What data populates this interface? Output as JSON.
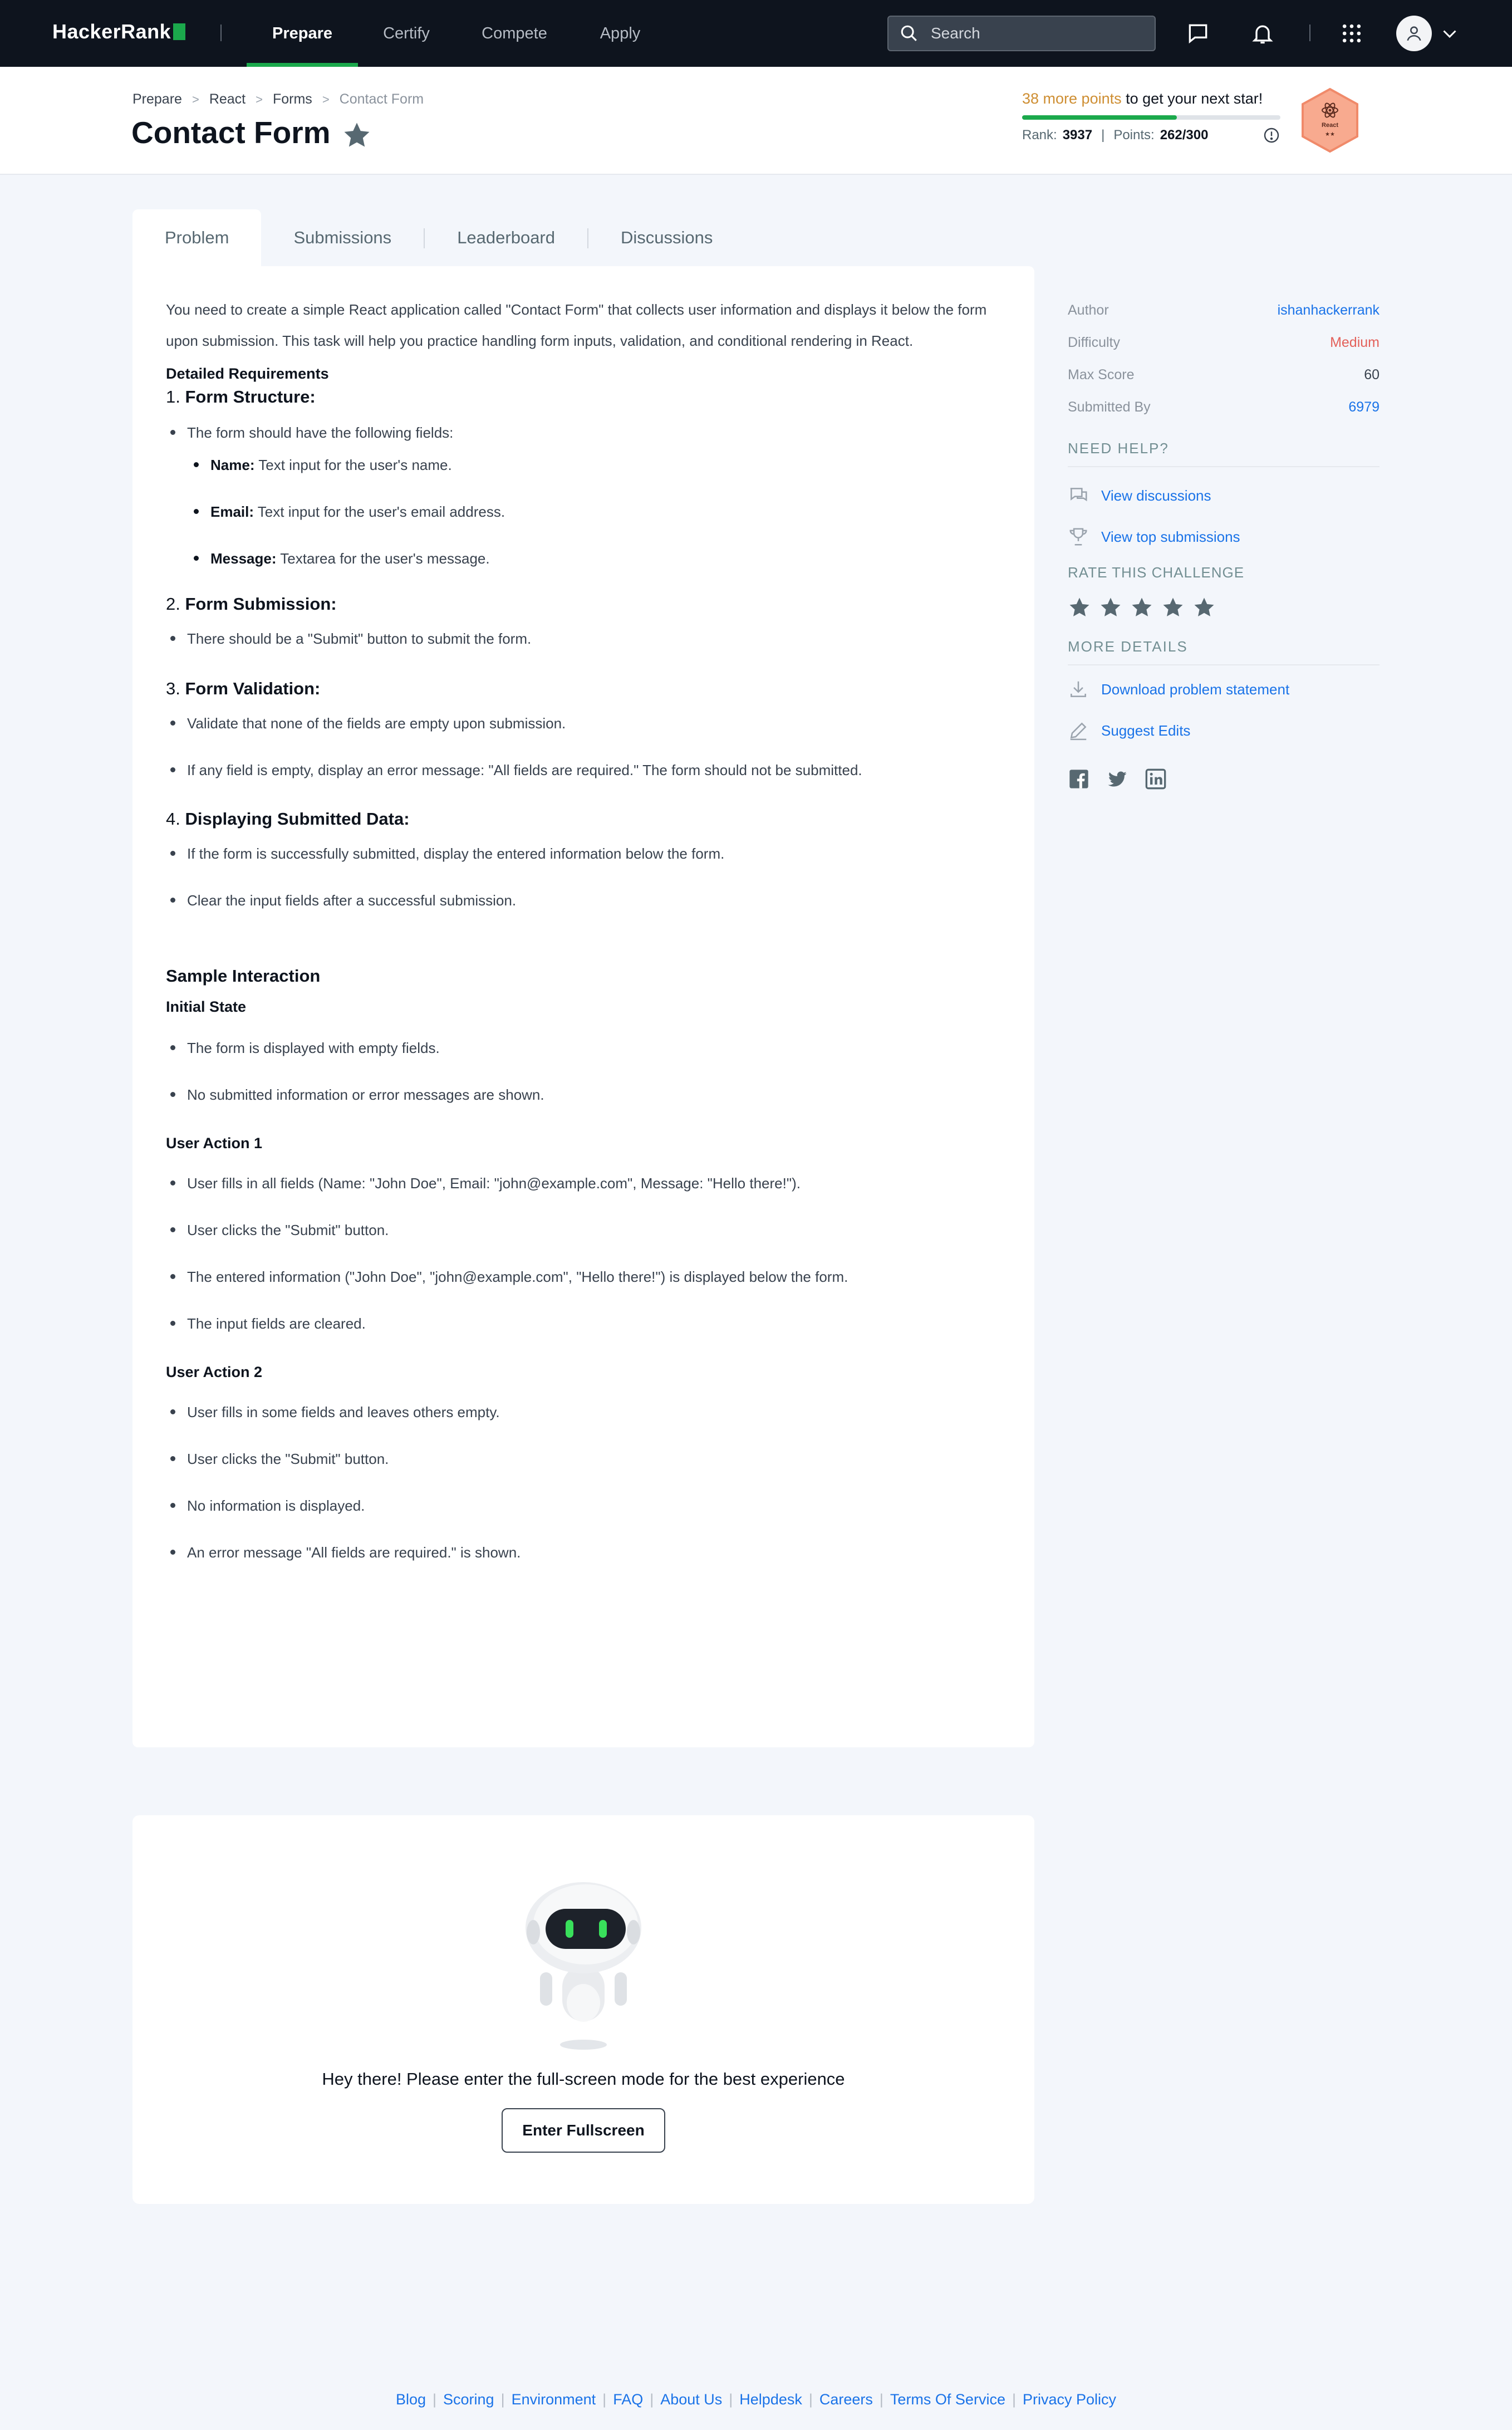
{
  "nav": {
    "logo": "HackerRank",
    "items": [
      "Prepare",
      "Certify",
      "Compete",
      "Apply"
    ],
    "active": "Prepare",
    "search_placeholder": "Search"
  },
  "header": {
    "breadcrumb": [
      "Prepare",
      "React",
      "Forms",
      "Contact Form"
    ],
    "title": "Contact Form",
    "points_needed": "38 more points",
    "points_suffix": " to get your next star!",
    "progress_fraction": 0.6,
    "rank_label": "Rank:",
    "rank_value": "3937",
    "points_label": "Points:",
    "points_value": "262/300",
    "badge_label": "React",
    "badge_stars": "★★"
  },
  "tabs": [
    "Problem",
    "Submissions",
    "Leaderboard",
    "Discussions"
  ],
  "problem": {
    "intro": "You need to create a simple React application called \"Contact Form\" that collects user information and displays it below the form upon submission. This task will help you practice handling form inputs, validation, and conditional rendering in React.",
    "detailed_requirements": "Detailed Requirements",
    "req1_num": "1. ",
    "req1_title": "Form Structure:",
    "req1_bullet": "The form should have the following fields:",
    "fields": [
      {
        "label": "Name:",
        "text": " Text input for the user's name."
      },
      {
        "label": "Email:",
        "text": " Text input for the user's email address."
      },
      {
        "label": "Message:",
        "text": " Textarea for the user's message."
      }
    ],
    "req2_num": "2. ",
    "req2_title": "Form Submission:",
    "req2_bullet": "There should be a \"Submit\" button to submit the form.",
    "req3_num": "3. ",
    "req3_title": "Form Validation:",
    "req3_bullets": [
      "Validate that none of the fields are empty upon submission.",
      "If any field is empty, display an error message: \"All fields are required.\" The form should not be submitted."
    ],
    "req4_num": "4. ",
    "req4_title": "Displaying Submitted Data:",
    "req4_bullets": [
      "If the form is successfully submitted, display the entered information below the form.",
      "Clear the input fields after a successful submission."
    ],
    "sample_title": "Sample Interaction",
    "initial_title": "Initial State",
    "initial_bullets": [
      "The form is displayed with empty fields.",
      "No submitted information or error messages are shown."
    ],
    "action1_title": "User Action 1",
    "action1_bullets": [
      "User fills in all fields (Name: \"John Doe\", Email: \"john@example.com\", Message: \"Hello there!\").",
      "User clicks the \"Submit\" button.",
      "The entered information (\"John Doe\", \"john@example.com\", \"Hello there!\") is displayed below the form.",
      "The input fields are cleared."
    ],
    "action2_title": "User Action 2",
    "action2_bullets": [
      "User fills in some fields and leaves others empty.",
      "User clicks the \"Submit\" button.",
      "No information is displayed.",
      "An error message \"All fields are required.\" is shown."
    ]
  },
  "sidebar": {
    "author_label": "Author",
    "author": "ishanhackerrank",
    "difficulty_label": "Difficulty",
    "difficulty": "Medium",
    "max_score_label": "Max Score",
    "max_score": "60",
    "submitted_by_label": "Submitted By",
    "submitted_by": "6979",
    "need_help": "NEED HELP?",
    "view_discussions": "View discussions",
    "view_top_submissions": "View top submissions",
    "rate_title": "RATE THIS CHALLENGE",
    "more_details": "MORE DETAILS",
    "download": "Download problem statement",
    "suggest": "Suggest Edits"
  },
  "fullscreen": {
    "message": "Hey there! Please enter the full-screen mode for the best experience",
    "button": "Enter Fullscreen"
  },
  "footer": [
    "Blog",
    "Scoring",
    "Environment",
    "FAQ",
    "About Us",
    "Helpdesk",
    "Careers",
    "Terms Of Service",
    "Privacy Policy"
  ],
  "colors": {
    "nav_bg": "#0e141e",
    "accent_green": "#1ba94c",
    "link_blue": "#1a73e8",
    "difficulty_red": "#e3605a",
    "points_orange": "#ce8e32"
  }
}
